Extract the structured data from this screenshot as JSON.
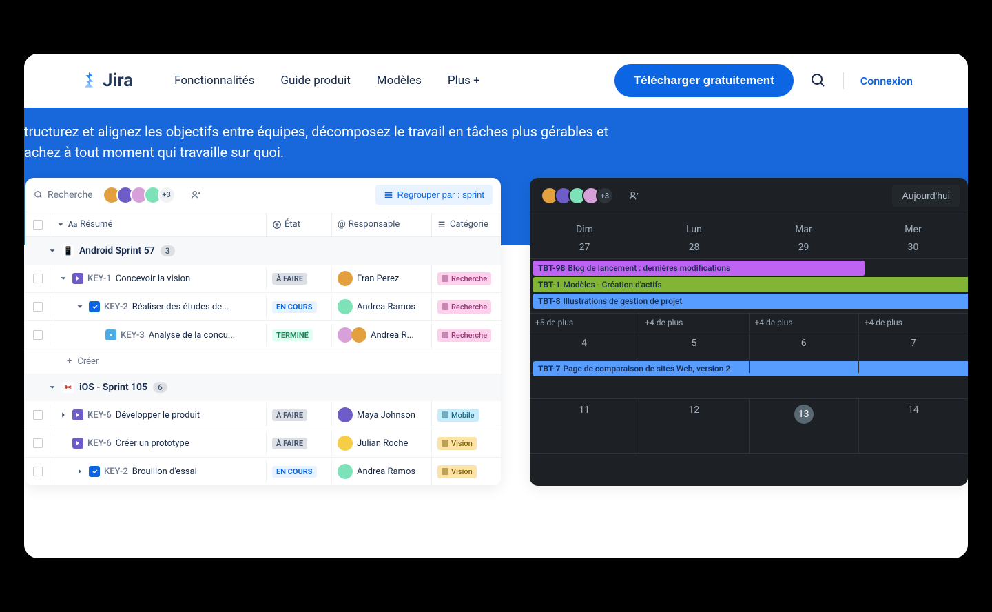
{
  "nav": {
    "brand": "Jira",
    "links": [
      "Fonctionnalités",
      "Guide produit",
      "Modèles",
      "Plus +"
    ],
    "cta": "Télécharger gratuitement",
    "login": "Connexion"
  },
  "hero": {
    "line1": "tructurez et alignez les objectifs entre équipes, décomposez le travail en tâches plus gérables et",
    "line2": "achez à tout moment qui travaille sur quoi."
  },
  "list": {
    "search": "Recherche",
    "avatar_more": "+3",
    "group_btn": "Regrouper par : sprint",
    "columns": {
      "summary": "Résumé",
      "status": "État",
      "assignee": "Responsable",
      "category": "Catégorie"
    },
    "sprints": [
      {
        "name": "Android Sprint 57",
        "count": "3",
        "icon_color": "#0C66E4",
        "tasks": [
          {
            "indent": 1,
            "icon": "epic",
            "key": "KEY-1",
            "title": "Concevoir la vision",
            "status": "À FAIRE",
            "status_class": "todo",
            "assignee": "Fran Perez",
            "avatar": "#E2A03F",
            "category": "Recherche",
            "cat_class": "research",
            "chevron": true
          },
          {
            "indent": 2,
            "icon": "check",
            "key": "KEY-2",
            "title": "Réaliser des études de...",
            "status": "EN COURS",
            "status_class": "progress",
            "assignee": "Andrea Ramos",
            "avatar": "#7EE2B8",
            "category": "Recherche",
            "cat_class": "research",
            "chevron": true
          },
          {
            "indent": 3,
            "icon": "sub",
            "key": "KEY-3",
            "title": "Analyse de la concu...",
            "status": "TERMINÉ",
            "status_class": "done",
            "assignee": "Andrea R...",
            "avatar": "#D8A0D8",
            "category": "Recherche",
            "cat_class": "research",
            "double_avatar": true
          }
        ],
        "create": "Créer"
      },
      {
        "name": "iOS - Sprint 105",
        "count": "6",
        "icon_color": "#C9372C",
        "tasks": [
          {
            "indent": 1,
            "icon": "epic",
            "key": "KEY-6",
            "title": "Développer le produit",
            "status": "À FAIRE",
            "status_class": "todo",
            "assignee": "Maya Johnson",
            "avatar": "#6E5DC6",
            "category": "Mobile",
            "cat_class": "mobile",
            "chevron_right": true
          },
          {
            "indent": 1,
            "icon": "epic",
            "key": "KEY-6",
            "title": "Créer un prototype",
            "status": "À FAIRE",
            "status_class": "todo",
            "assignee": "Julian Roche",
            "avatar": "#F5CD47",
            "category": "Vision",
            "cat_class": "vision"
          },
          {
            "indent": 2,
            "icon": "check",
            "key": "KEY-2",
            "title": "Brouillon d'essai",
            "status": "EN COURS",
            "status_class": "progress",
            "assignee": "Andrea Ramos",
            "avatar": "#7EE2B8",
            "category": "Vision",
            "cat_class": "vision",
            "chevron_right": true
          }
        ]
      }
    ]
  },
  "calendar": {
    "avatar_more": "+3",
    "today": "Aujourd'hui",
    "days": [
      "Dim",
      "Lun",
      "Mar",
      "Mer"
    ],
    "week1_dates": [
      "27",
      "28",
      "29",
      "30"
    ],
    "events": [
      {
        "key": "TBT-98",
        "title": "Blog de lancement : dernières modifications",
        "class": "purple",
        "width": "76%"
      },
      {
        "key": "TBT-1",
        "title": "Modèles - Création d'actifs",
        "class": "green",
        "width": "100%"
      },
      {
        "key": "TBT-8",
        "title": "Illustrations de gestion de projet",
        "class": "blue",
        "width": "100%"
      }
    ],
    "more": [
      "+5 de plus",
      "+4 de plus",
      "+4 de plus",
      "+4 de plus"
    ],
    "week2_dates": [
      "4",
      "5",
      "6",
      "7"
    ],
    "week2_events": [
      {
        "key": "TBT-7",
        "title": "Page de comparaison de sites Web, version 2",
        "class": "blue",
        "width": "100%"
      }
    ],
    "week3_dates": [
      "11",
      "12",
      "13",
      "14"
    ],
    "today_date": "13"
  }
}
